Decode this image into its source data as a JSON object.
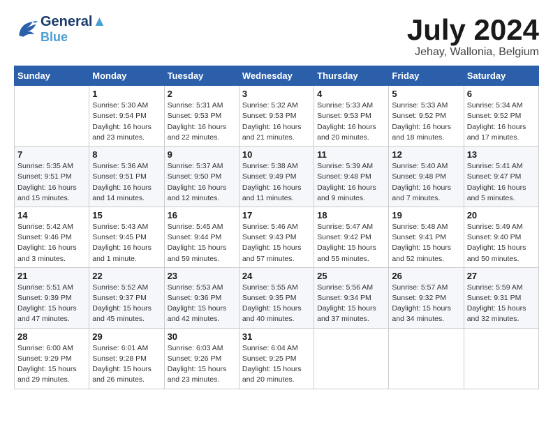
{
  "header": {
    "logo_line1": "General",
    "logo_line2": "Blue",
    "month": "July 2024",
    "location": "Jehay, Wallonia, Belgium"
  },
  "weekdays": [
    "Sunday",
    "Monday",
    "Tuesday",
    "Wednesday",
    "Thursday",
    "Friday",
    "Saturday"
  ],
  "weeks": [
    [
      {
        "day": "",
        "info": ""
      },
      {
        "day": "1",
        "info": "Sunrise: 5:30 AM\nSunset: 9:54 PM\nDaylight: 16 hours\nand 23 minutes."
      },
      {
        "day": "2",
        "info": "Sunrise: 5:31 AM\nSunset: 9:53 PM\nDaylight: 16 hours\nand 22 minutes."
      },
      {
        "day": "3",
        "info": "Sunrise: 5:32 AM\nSunset: 9:53 PM\nDaylight: 16 hours\nand 21 minutes."
      },
      {
        "day": "4",
        "info": "Sunrise: 5:33 AM\nSunset: 9:53 PM\nDaylight: 16 hours\nand 20 minutes."
      },
      {
        "day": "5",
        "info": "Sunrise: 5:33 AM\nSunset: 9:52 PM\nDaylight: 16 hours\nand 18 minutes."
      },
      {
        "day": "6",
        "info": "Sunrise: 5:34 AM\nSunset: 9:52 PM\nDaylight: 16 hours\nand 17 minutes."
      }
    ],
    [
      {
        "day": "7",
        "info": "Sunrise: 5:35 AM\nSunset: 9:51 PM\nDaylight: 16 hours\nand 15 minutes."
      },
      {
        "day": "8",
        "info": "Sunrise: 5:36 AM\nSunset: 9:51 PM\nDaylight: 16 hours\nand 14 minutes."
      },
      {
        "day": "9",
        "info": "Sunrise: 5:37 AM\nSunset: 9:50 PM\nDaylight: 16 hours\nand 12 minutes."
      },
      {
        "day": "10",
        "info": "Sunrise: 5:38 AM\nSunset: 9:49 PM\nDaylight: 16 hours\nand 11 minutes."
      },
      {
        "day": "11",
        "info": "Sunrise: 5:39 AM\nSunset: 9:48 PM\nDaylight: 16 hours\nand 9 minutes."
      },
      {
        "day": "12",
        "info": "Sunrise: 5:40 AM\nSunset: 9:48 PM\nDaylight: 16 hours\nand 7 minutes."
      },
      {
        "day": "13",
        "info": "Sunrise: 5:41 AM\nSunset: 9:47 PM\nDaylight: 16 hours\nand 5 minutes."
      }
    ],
    [
      {
        "day": "14",
        "info": "Sunrise: 5:42 AM\nSunset: 9:46 PM\nDaylight: 16 hours\nand 3 minutes."
      },
      {
        "day": "15",
        "info": "Sunrise: 5:43 AM\nSunset: 9:45 PM\nDaylight: 16 hours\nand 1 minute."
      },
      {
        "day": "16",
        "info": "Sunrise: 5:45 AM\nSunset: 9:44 PM\nDaylight: 15 hours\nand 59 minutes."
      },
      {
        "day": "17",
        "info": "Sunrise: 5:46 AM\nSunset: 9:43 PM\nDaylight: 15 hours\nand 57 minutes."
      },
      {
        "day": "18",
        "info": "Sunrise: 5:47 AM\nSunset: 9:42 PM\nDaylight: 15 hours\nand 55 minutes."
      },
      {
        "day": "19",
        "info": "Sunrise: 5:48 AM\nSunset: 9:41 PM\nDaylight: 15 hours\nand 52 minutes."
      },
      {
        "day": "20",
        "info": "Sunrise: 5:49 AM\nSunset: 9:40 PM\nDaylight: 15 hours\nand 50 minutes."
      }
    ],
    [
      {
        "day": "21",
        "info": "Sunrise: 5:51 AM\nSunset: 9:39 PM\nDaylight: 15 hours\nand 47 minutes."
      },
      {
        "day": "22",
        "info": "Sunrise: 5:52 AM\nSunset: 9:37 PM\nDaylight: 15 hours\nand 45 minutes."
      },
      {
        "day": "23",
        "info": "Sunrise: 5:53 AM\nSunset: 9:36 PM\nDaylight: 15 hours\nand 42 minutes."
      },
      {
        "day": "24",
        "info": "Sunrise: 5:55 AM\nSunset: 9:35 PM\nDaylight: 15 hours\nand 40 minutes."
      },
      {
        "day": "25",
        "info": "Sunrise: 5:56 AM\nSunset: 9:34 PM\nDaylight: 15 hours\nand 37 minutes."
      },
      {
        "day": "26",
        "info": "Sunrise: 5:57 AM\nSunset: 9:32 PM\nDaylight: 15 hours\nand 34 minutes."
      },
      {
        "day": "27",
        "info": "Sunrise: 5:59 AM\nSunset: 9:31 PM\nDaylight: 15 hours\nand 32 minutes."
      }
    ],
    [
      {
        "day": "28",
        "info": "Sunrise: 6:00 AM\nSunset: 9:29 PM\nDaylight: 15 hours\nand 29 minutes."
      },
      {
        "day": "29",
        "info": "Sunrise: 6:01 AM\nSunset: 9:28 PM\nDaylight: 15 hours\nand 26 minutes."
      },
      {
        "day": "30",
        "info": "Sunrise: 6:03 AM\nSunset: 9:26 PM\nDaylight: 15 hours\nand 23 minutes."
      },
      {
        "day": "31",
        "info": "Sunrise: 6:04 AM\nSunset: 9:25 PM\nDaylight: 15 hours\nand 20 minutes."
      },
      {
        "day": "",
        "info": ""
      },
      {
        "day": "",
        "info": ""
      },
      {
        "day": "",
        "info": ""
      }
    ]
  ]
}
